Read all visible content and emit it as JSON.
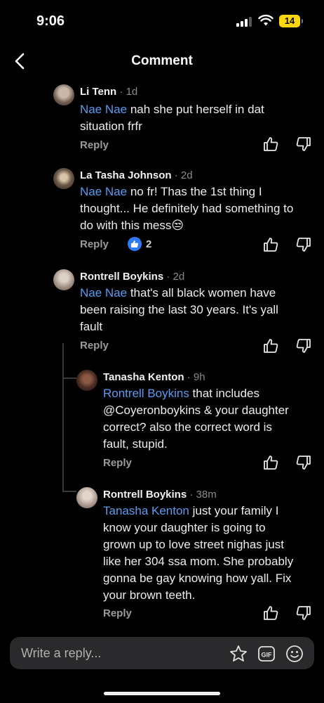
{
  "status_bar": {
    "time": "9:06",
    "battery": "14"
  },
  "header": {
    "title": "Comment"
  },
  "comments": [
    {
      "author": "Li Tenn",
      "age": "1d",
      "mention": "Nae Nae",
      "text_lines": [
        " nah she put herself in dat",
        "situation frfr"
      ],
      "reply_label": "Reply"
    },
    {
      "author": "La Tasha Johnson",
      "age": "2d",
      "mention": "Nae Nae",
      "text_lines": [
        "  no fr! Thas the 1st thing I",
        "thought... He definitely had something to",
        "do with this mess😒"
      ],
      "reply_label": "Reply",
      "reaction_count": "2"
    },
    {
      "author": "Rontrell Boykins",
      "age": "2d",
      "mention": "Nae Nae",
      "text_lines": [
        " that's all black women have",
        "been raising the last 30 years. It's yall",
        "fault"
      ],
      "reply_label": "Reply"
    },
    {
      "author": "Tanasha Kenton",
      "age": "9h",
      "mention": "Rontrell Boykins",
      "text_lines": [
        " that includes",
        "@Coyeronboykins & your daughter",
        "correct? also the correct word is",
        "fault, stupid."
      ],
      "reply_label": "Reply"
    },
    {
      "author": "Rontrell Boykins",
      "age": "38m",
      "mention": "Tanasha Kenton",
      "text_lines": [
        " just your family I",
        "know your daughter is going to",
        "grown up to love street nighas just",
        "like her 304 ssa mom. She probably",
        "gonna be gay knowing how yall. Fix",
        "your brown teeth."
      ],
      "reply_label": "Reply"
    }
  ],
  "composer": {
    "placeholder": "Write a reply..."
  },
  "icons": [
    "back-arrow-icon",
    "thumbs-up-icon",
    "thumbs-down-icon",
    "sticker-icon",
    "gif-icon",
    "emoji-icon"
  ],
  "colors": {
    "background": "#000000",
    "mention": "#5b9bf0",
    "like_badge": "#2f7bf5",
    "battery": "#ffd60a"
  }
}
